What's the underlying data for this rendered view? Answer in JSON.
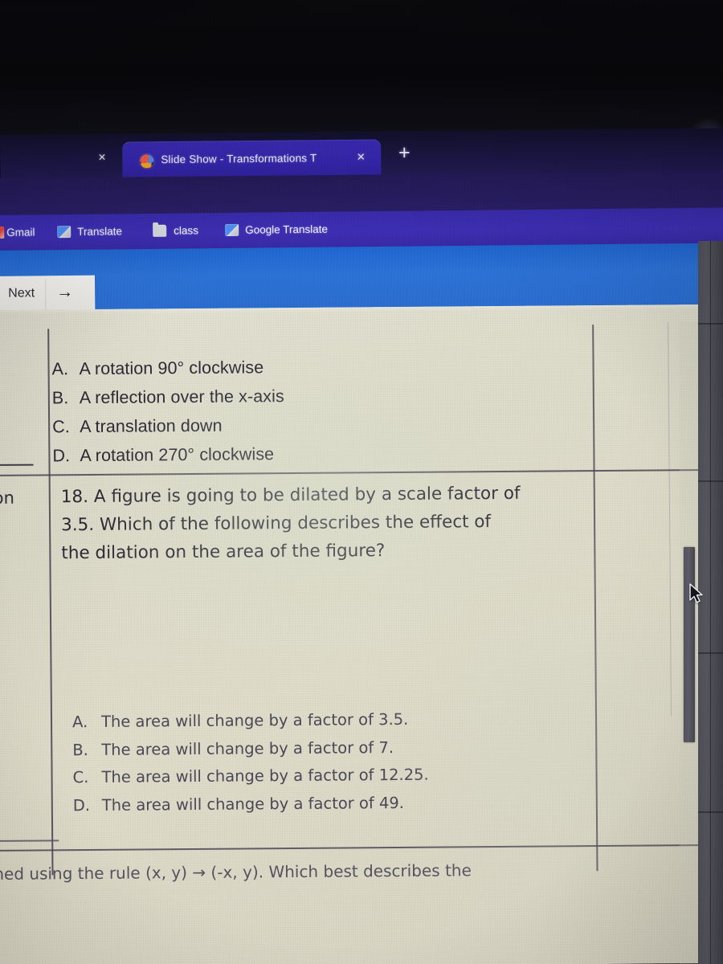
{
  "browser": {
    "tab": {
      "favicon": "slides-favicon",
      "title": "Slide Show - Transformations T",
      "title_visible": "Slide Show - Transformations",
      "title_truncated_suffix": "T",
      "close_label": "×",
      "left_close_label": "×"
    },
    "new_tab_label": "+",
    "bookmarks": [
      {
        "label": "Gmail",
        "icon": "gmail-icon"
      },
      {
        "label": "Translate",
        "icon": "translate-icon"
      },
      {
        "label": "class",
        "icon": "folder-icon"
      },
      {
        "label": "Google Translate",
        "icon": "translate-icon"
      }
    ]
  },
  "toolbar": {
    "next_label": "Next",
    "next_arrow": "→",
    "bar_color": "#2c72d6"
  },
  "document": {
    "background_color": "#dedccb",
    "previous_question_options": [
      {
        "letter": "A.",
        "text": "A rotation 90° clockwise"
      },
      {
        "letter": "B.",
        "text": "A reflection over the x-axis"
      },
      {
        "letter": "C.",
        "text": "A translation down"
      },
      {
        "letter": "D.",
        "text": "A rotation 270° clockwise"
      }
    ],
    "left_column_fragment": "ion",
    "question_18": {
      "number": "18.",
      "lines": [
        "18. A figure is going to be dilated by a scale factor of",
        "3.5. Which of the following describes the effect of",
        "the dilation on the area of the figure?"
      ],
      "options": [
        {
          "letter": "A.",
          "text": "The area will change by a factor of 3.5."
        },
        {
          "letter": "B.",
          "text": "The area will change by a factor of 7."
        },
        {
          "letter": "C.",
          "text": "The area will change by a factor of 12.25."
        },
        {
          "letter": "D.",
          "text": "The area will change by a factor of 49."
        }
      ]
    },
    "next_question_partial": "med using the rule (x, y) → (-x, y). Which best describes the"
  },
  "scrollbar": {
    "orientation": "vertical",
    "thumb_color": "#53525c"
  },
  "cursor": {
    "type": "arrow-pointer"
  }
}
